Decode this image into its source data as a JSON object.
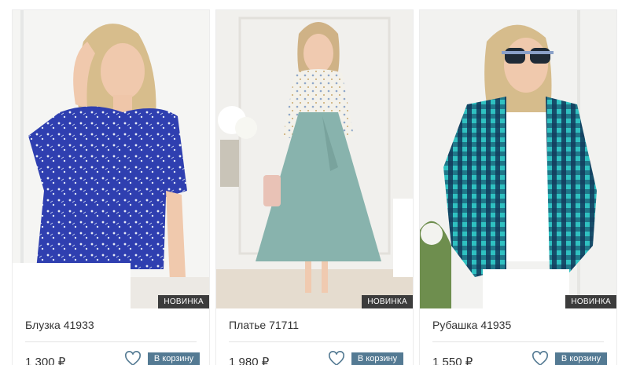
{
  "products": [
    {
      "name": "Блузка 41933",
      "price": "1 300 ₽",
      "badge": "НОВИНКА",
      "cart_label": "В корзину",
      "image": "blue-floral-blouse",
      "accent": "#2f3fb0"
    },
    {
      "name": "Платье 71711",
      "price": "1 980 ₽",
      "badge": "НОВИНКА",
      "cart_label": "В корзину",
      "image": "mint-skirt-dress",
      "accent": "#88b3ad"
    },
    {
      "name": "Рубашка 41935",
      "price": "1 550 ₽",
      "badge": "НОВИНКА",
      "cart_label": "В корзину",
      "image": "checked-shirt",
      "accent": "#1f8f94"
    }
  ],
  "colors": {
    "button": "#547a93",
    "badge": "#3c3c3c",
    "heart": "#547a93"
  },
  "icons": {
    "favorite": "heart-icon"
  }
}
